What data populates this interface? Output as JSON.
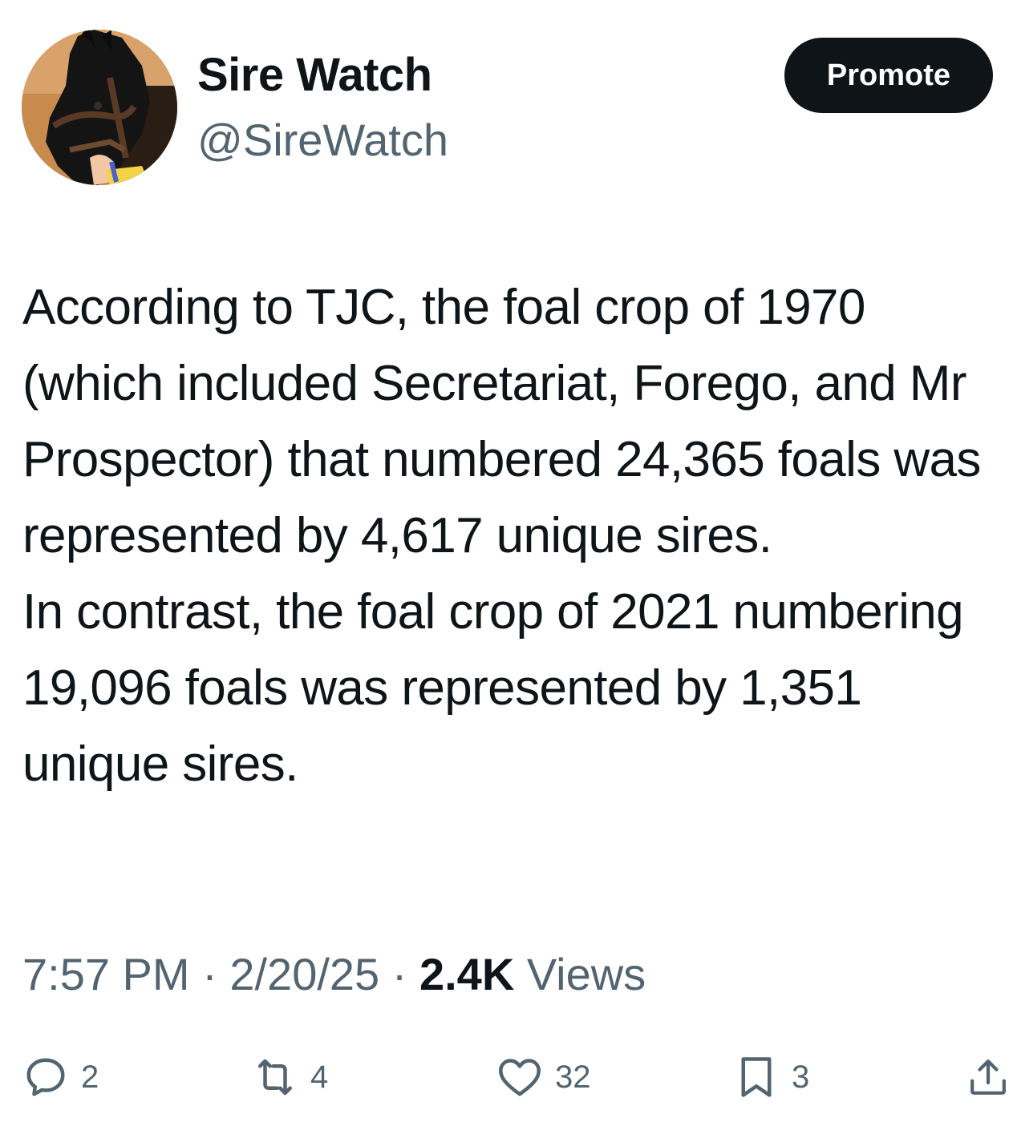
{
  "author": {
    "display_name": "Sire Watch",
    "handle": "@SireWatch",
    "avatar_icon": "horse-avatar"
  },
  "header": {
    "promote_label": "Promote"
  },
  "tweet": {
    "paragraphs": [
      "According to TJC, the foal crop of 1970 (which included Secretariat, Forego, and Mr Prospector) that numbered 24,365 foals was represented by 4,617 unique sires.",
      "In contrast, the foal crop of 2021 numbering 19,096 foals was represented by 1,351 unique sires."
    ]
  },
  "meta": {
    "time": "7:57 PM",
    "separator": "·",
    "date": "2/20/25",
    "views_count": "2.4K",
    "views_label": "Views"
  },
  "actions": {
    "replies": "2",
    "reposts": "4",
    "likes": "32",
    "bookmarks": "3"
  },
  "colors": {
    "text_primary": "#0f1419",
    "text_secondary": "#536471",
    "button_bg": "#0f1419",
    "button_text": "#ffffff"
  }
}
